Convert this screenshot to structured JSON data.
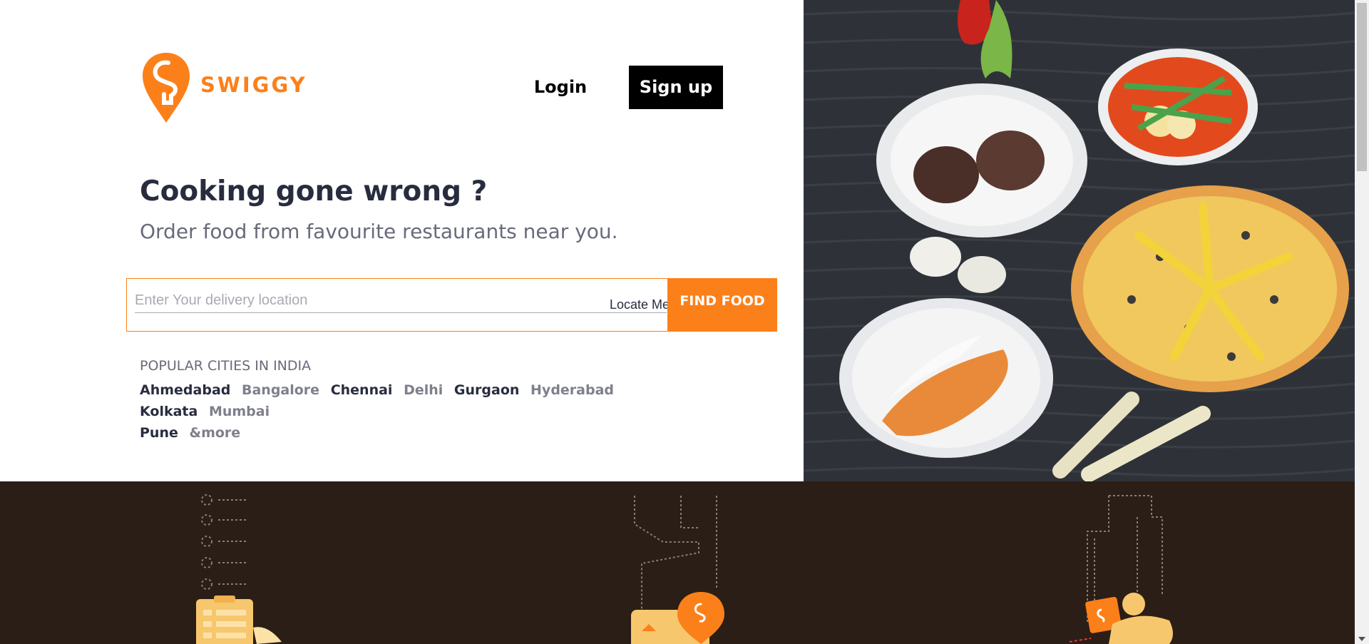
{
  "brand": {
    "name": "SWIGGY",
    "color": "#fc8019"
  },
  "header": {
    "login_label": "Login",
    "signup_label": "Sign up"
  },
  "hero": {
    "headline": "Cooking gone wrong ?",
    "subheadline": "Order food from favourite restaurants near you."
  },
  "search": {
    "placeholder": "Enter Your delivery location",
    "locate_label": "Locate Me",
    "find_label": "FIND FOOD"
  },
  "cities": {
    "title": "POPULAR CITIES IN INDIA",
    "items": [
      {
        "name": "Ahmedabad",
        "tone": "dark"
      },
      {
        "name": "Bangalore",
        "tone": "grey"
      },
      {
        "name": "Chennai",
        "tone": "dark"
      },
      {
        "name": "Delhi",
        "tone": "grey"
      },
      {
        "name": "Gurgaon",
        "tone": "dark"
      },
      {
        "name": "Hyderabad",
        "tone": "grey"
      },
      {
        "name": "Kolkata",
        "tone": "dark"
      },
      {
        "name": "Mumbai",
        "tone": "grey"
      },
      {
        "name": "Pune",
        "tone": "dark"
      },
      {
        "name": "&more",
        "tone": "grey"
      }
    ]
  },
  "icons": {
    "hero_image": "food-platter-illustration",
    "footer_left": "order-checklist-illustration",
    "footer_middle": "location-pin-map-illustration",
    "footer_right": "delivery-rider-illustration"
  }
}
